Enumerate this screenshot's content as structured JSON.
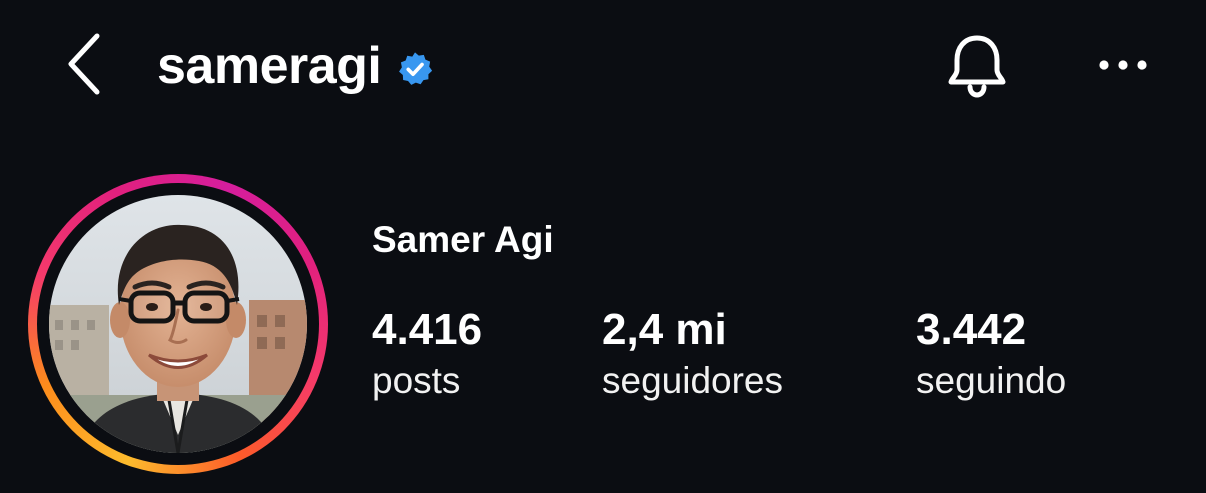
{
  "header": {
    "username": "sameragi",
    "verified_color": "#3897f0",
    "back_icon": "chevron-left-icon",
    "bell_icon": "bell-icon",
    "more_icon": "more-horizontal-icon"
  },
  "profile": {
    "display_name": "Samer Agi",
    "story_ring_colors": [
      "#fdbb2d",
      "#f5396b",
      "#d61e9d"
    ],
    "avatar_icon": "profile-photo"
  },
  "stats": {
    "posts": {
      "value": "4.416",
      "label": "posts"
    },
    "followers": {
      "value": "2,4 mi",
      "label": "seguidores"
    },
    "following": {
      "value": "3.442",
      "label": "seguindo"
    }
  }
}
